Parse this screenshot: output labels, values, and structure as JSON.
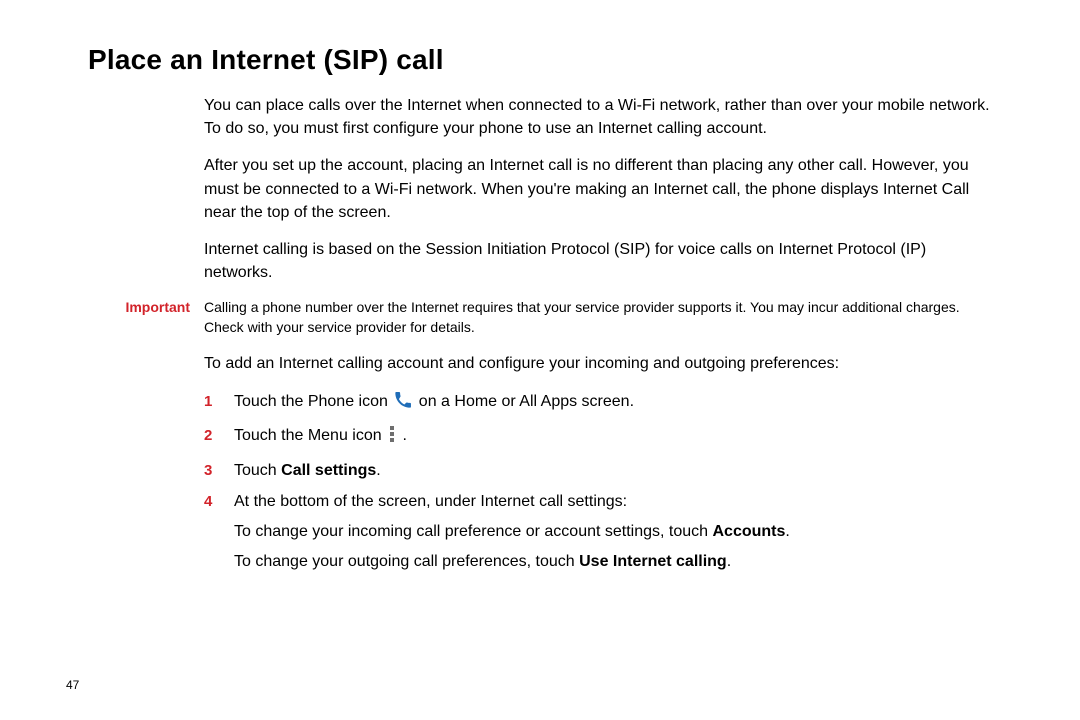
{
  "title": "Place an Internet (SIP) call",
  "paragraphs": {
    "p1": "You can place calls over the Internet when connected to a Wi-Fi network, rather than over your mobile network. To do so, you must first configure your phone to use an Internet calling account.",
    "p2": "After you set up the account, placing an Internet call is no different than placing any other call. However, you must be connected to a Wi-Fi network. When you're making an Internet call, the phone displays Internet Call near the top of the screen.",
    "p3": "Internet calling is based on the Session Initiation Protocol (SIP) for voice calls on Internet Protocol (IP) networks."
  },
  "important": {
    "label": "Important",
    "text": "Calling a phone number over the Internet requires that your service provider supports it. You may incur additional charges. Check with your service provider for details."
  },
  "lead_in": "To add an Internet calling account and configure your incoming and outgoing preferences:",
  "steps": {
    "s1_pre": "Touch the Phone icon ",
    "s1_post": " on a Home or All Apps screen.",
    "s2_pre": "Touch the Menu icon ",
    "s2_post": " .",
    "s3_pre": "Touch ",
    "s3_bold": "Call settings",
    "s3_post": ".",
    "s4_line1": "At the bottom of the screen, under Internet call settings:",
    "s4_line2_pre": "To change your incoming call preference or account settings, touch ",
    "s4_line2_bold": "Accounts",
    "s4_line2_post": ".",
    "s4_line3_pre": "To change your outgoing call preferences, touch ",
    "s4_line3_bold": "Use Internet calling",
    "s4_line3_post": "."
  },
  "nums": {
    "n1": "1",
    "n2": "2",
    "n3": "3",
    "n4": "4"
  },
  "page_number": "47"
}
